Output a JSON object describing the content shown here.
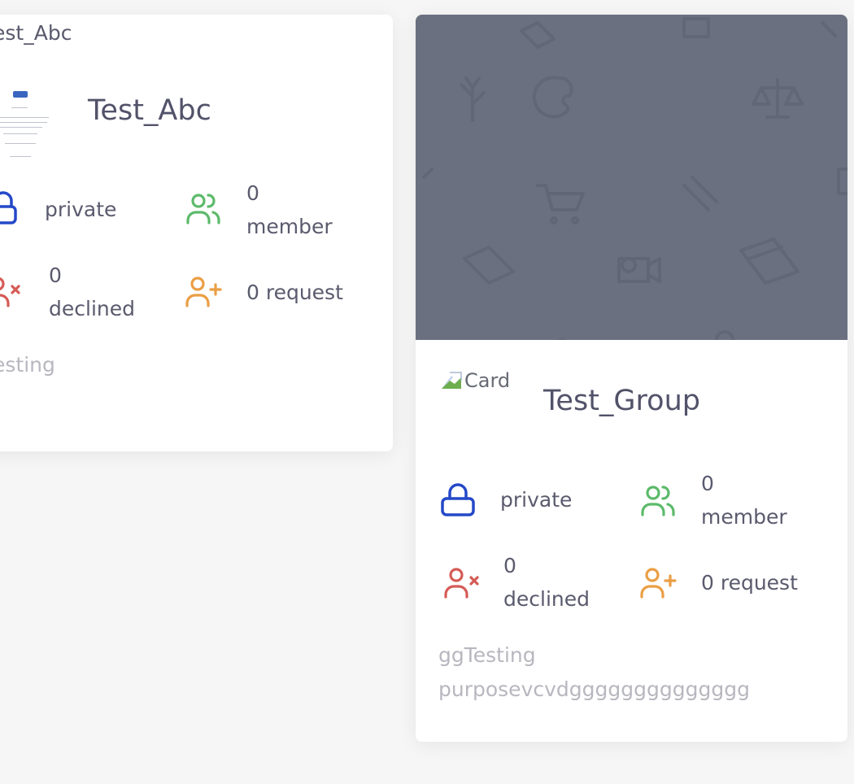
{
  "groups": [
    {
      "top_label": "Test_Abc",
      "name": "Test_Abc",
      "privacy": "private",
      "members": "0\nmember",
      "declined": "0\ndeclined",
      "requests": "0 request",
      "description": "Testing"
    },
    {
      "cover_alt": "Card",
      "name": "Test_Group",
      "privacy": "private",
      "members": "0\nmember",
      "declined": "0\ndeclined",
      "requests": "0 request",
      "description": "ggTesting\npurposevcvdgggggggggggggg"
    }
  ],
  "colors": {
    "private_icon": "#2448c8",
    "member_icon": "#5cba6a",
    "declined_icon": "#d55b55",
    "request_icon": "#ea9e44",
    "cover_bg": "#6b7080"
  },
  "icons": {
    "privacy": "lock-icon",
    "members": "users-icon",
    "declined": "user-x-icon",
    "requests": "user-plus-icon"
  }
}
